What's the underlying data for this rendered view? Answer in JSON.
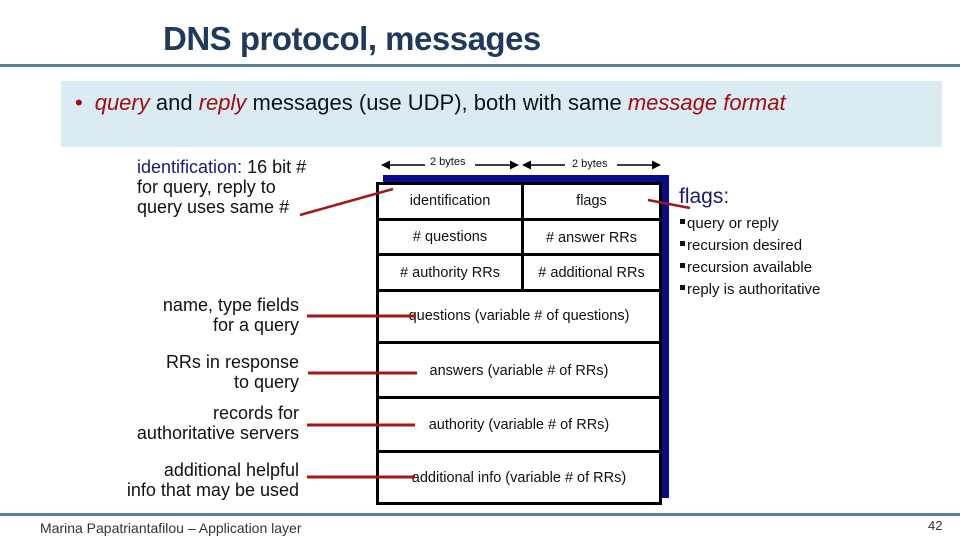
{
  "slide": {
    "title": "DNS protocol, messages",
    "bullet": {
      "parts": [
        {
          "text": "query",
          "emphasis": true
        },
        {
          "text": " and ",
          "emphasis": false
        },
        {
          "text": "reply",
          "emphasis": true
        },
        {
          "text": " messages (use UDP), both with same ",
          "emphasis": false
        },
        {
          "text": "message format",
          "emphasis": true
        }
      ]
    },
    "identification_note": {
      "term": "identification:",
      "line1_rest": " 16 bit #",
      "line2": "for query, reply to",
      "line3": "query uses same #"
    },
    "section_notes": [
      {
        "line1": "name, type fields",
        "line2": "for a query"
      },
      {
        "line1": "RRs in response",
        "line2": "to query"
      },
      {
        "line1": "records for",
        "line2": "authoritative servers"
      },
      {
        "line1": "additional helpful",
        "line2": "info that may be used"
      }
    ],
    "flags": {
      "title": "flags:",
      "items": [
        "query or reply",
        "recursion desired",
        "recursion available",
        "reply is authoritative"
      ]
    },
    "message_format": {
      "byte_labels": [
        "2 bytes",
        "2 bytes"
      ],
      "header_rows": [
        [
          "identification",
          "flags"
        ],
        [
          "# questions",
          "# answer RRs"
        ],
        [
          "# authority RRs",
          "# additional RRs"
        ]
      ],
      "sections": [
        "questions (variable # of questions)",
        "answers (variable # of RRs)",
        "authority (variable # of RRs)",
        "additional info (variable # of RRs)"
      ]
    },
    "footer": {
      "author": "Marina Papatriantafilou – Application layer",
      "page_number": "42"
    },
    "colors": {
      "title": "#1f3a5a",
      "rule": "#5a7fa0",
      "bullet_box": "#dbebf2",
      "emphasis": "#a00d12",
      "pointer": "#a01818",
      "shadow": "#0a0a8a",
      "navy_text": "#1a1a70"
    }
  }
}
